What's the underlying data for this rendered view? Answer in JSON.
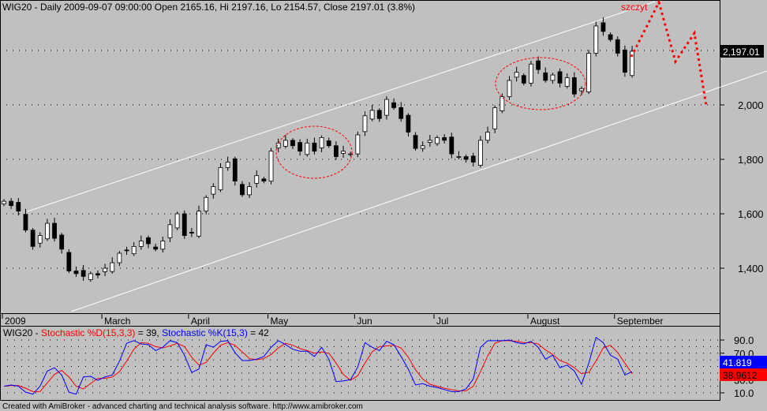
{
  "header": {
    "symbol": "WIG20",
    "info": "WIG20 - Daily 2009-09-07 09:00:00 Open 2165.16, Hi 2197.16, Lo 2154.57, Close 2197.01 (3.8%)"
  },
  "annotation": {
    "label": "szczyt"
  },
  "price_badge": "2,197.01",
  "stoch_title": {
    "prefix": "WIG20 - ",
    "d_label": "Stochastic %D(15,3,3)",
    "d_value": " = 39, ",
    "k_label": "Stochastic %K(15,3)",
    "k_value": " = 42"
  },
  "stoch_badges": {
    "k": "41.819",
    "d": "38.9612"
  },
  "footer": "Created with AmiBroker - advanced charting and technical analysis software. http://www.amibroker.com",
  "colors": {
    "bg": "#c0c0c0",
    "k": "#0000ff",
    "d": "#ff0000",
    "forecast": "#ff0000"
  },
  "chart_data": [
    {
      "type": "candlestick",
      "title": "WIG20 - Daily",
      "ylim": [
        1250,
        2400
      ],
      "yticks": [
        "2,000",
        "1,800",
        "1,600",
        "1,400"
      ],
      "ytick_values": [
        2000,
        1800,
        1600,
        1400
      ],
      "xticks": [
        "2009",
        "March",
        "April",
        "May",
        "Jun",
        "Jul",
        "August",
        "September"
      ],
      "xtick_bars": [
        0,
        14,
        26,
        37,
        49,
        60,
        73,
        85
      ],
      "closes": [
        1646,
        1630,
        1610,
        1540,
        1480,
        1520,
        1565,
        1510,
        1470,
        1390,
        1380,
        1370,
        1380,
        1375,
        1400,
        1420,
        1455,
        1465,
        1480,
        1500,
        1490,
        1470,
        1500,
        1560,
        1600,
        1520,
        1530,
        1610,
        1660,
        1700,
        1770,
        1790,
        1720,
        1670,
        1700,
        1740,
        1720,
        1830,
        1860,
        1870,
        1850,
        1830,
        1860,
        1830,
        1880,
        1850,
        1810,
        1830,
        1820,
        1890,
        1960,
        1980,
        1950,
        2020,
        1990,
        1950,
        1900,
        1840,
        1850,
        1870,
        1880,
        1870,
        1820,
        1810,
        1800,
        1790,
        1870,
        1900,
        1990,
        2030,
        2090,
        2120,
        2080,
        2150,
        2130,
        2090,
        2110,
        2080,
        2100,
        2040,
        2060,
        2190,
        2290,
        2270,
        2240,
        2190,
        2120,
        2197
      ]
    },
    {
      "type": "line",
      "title": "Stochastic",
      "ylim": [
        0,
        100
      ],
      "yticks": [
        "90.0",
        "70.0",
        "50.0",
        "30.0",
        "10.0"
      ],
      "ytick_values": [
        90,
        70,
        50,
        30,
        10
      ],
      "series": [
        {
          "name": "Stochastic %K(15,3)",
          "values": [
            20,
            22,
            20,
            11,
            8,
            20,
            43,
            48,
            37,
            11,
            8,
            34,
            35,
            29,
            34,
            37,
            58,
            85,
            89,
            84,
            83,
            74,
            79,
            89,
            86,
            67,
            41,
            46,
            83,
            79,
            88,
            89,
            71,
            59,
            59,
            61,
            65,
            79,
            89,
            83,
            76,
            73,
            73,
            65,
            79,
            61,
            27,
            28,
            30,
            49,
            86,
            79,
            74,
            88,
            83,
            65,
            46,
            22,
            24,
            20,
            18,
            15,
            12,
            12,
            16,
            31,
            79,
            89,
            89,
            89,
            90,
            86,
            84,
            88,
            79,
            61,
            67,
            48,
            52,
            43,
            23,
            55,
            94,
            86,
            67,
            61,
            37,
            42
          ]
        },
        {
          "name": "Stochastic %D(15,3,3)",
          "values": [
            20,
            21,
            21,
            17,
            12,
            12,
            25,
            38,
            44,
            34,
            20,
            16,
            24,
            32,
            32,
            34,
            42,
            58,
            76,
            86,
            85,
            80,
            78,
            81,
            85,
            80,
            64,
            52,
            56,
            70,
            82,
            86,
            82,
            72,
            62,
            60,
            62,
            68,
            78,
            85,
            82,
            77,
            74,
            70,
            72,
            70,
            55,
            38,
            29,
            36,
            55,
            72,
            80,
            81,
            82,
            78,
            64,
            45,
            31,
            23,
            20,
            17,
            15,
            13,
            13,
            20,
            42,
            66,
            85,
            89,
            89,
            88,
            86,
            86,
            84,
            75,
            68,
            59,
            55,
            48,
            39,
            41,
            58,
            78,
            82,
            71,
            55,
            39
          ]
        }
      ]
    }
  ]
}
